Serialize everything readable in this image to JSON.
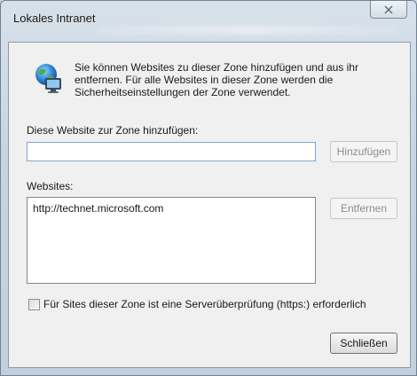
{
  "window": {
    "title": "Lokales Intranet"
  },
  "info": {
    "text": "Sie können Websites zu dieser Zone hinzufügen und aus ihr entfernen. Für alle Websites in dieser Zone werden die Sicherheitseinstellungen der Zone verwendet."
  },
  "add_section": {
    "label": "Diese Website zur Zone hinzufügen:",
    "input_value": "",
    "add_button": "Hinzufügen"
  },
  "websites_section": {
    "label": "Websites:",
    "items": [
      "http://technet.microsoft.com"
    ],
    "remove_button": "Entfernen"
  },
  "https_option": {
    "label": "Für Sites dieser Zone ist eine Serverüberprüfung (https:) erforderlich",
    "checked": false
  },
  "footer": {
    "close_button": "Schließen"
  },
  "icons": {
    "window_close": "close-icon",
    "zone": "globe-computer-icon"
  }
}
